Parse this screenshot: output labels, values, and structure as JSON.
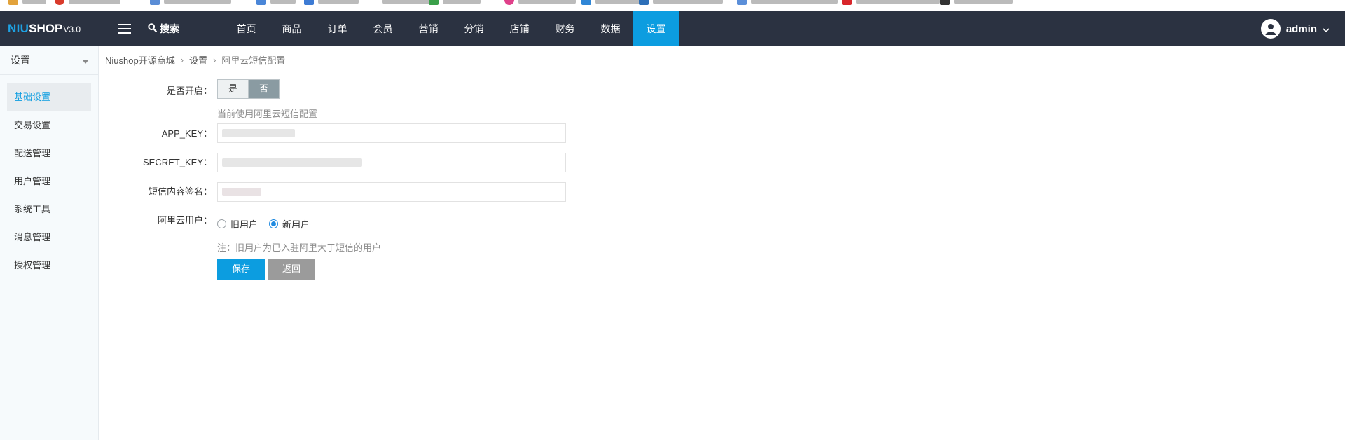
{
  "logo": {
    "part1": "NIU",
    "part2": "SHOP",
    "version": "V3.0"
  },
  "header": {
    "search_label": "搜索",
    "nav": [
      "首页",
      "商品",
      "订单",
      "会员",
      "营销",
      "分销",
      "店铺",
      "财务",
      "数据",
      "设置"
    ],
    "active_nav": "设置",
    "user": "admin"
  },
  "colors": {
    "topbar": "#2b3241",
    "accent": "#0c9de0",
    "logo_accent": "#1ea2e3"
  },
  "sidebar": {
    "title": "设置",
    "items": [
      "基础设置",
      "交易设置",
      "配送管理",
      "用户管理",
      "系统工具",
      "消息管理",
      "授权管理"
    ],
    "active": "基础设置"
  },
  "breadcrumb": [
    "Niushop开源商城",
    "设置",
    "阿里云短信配置"
  ],
  "form": {
    "enable_label": "是否开启：",
    "enable_yes": "是",
    "enable_no": "否",
    "enable_hint": "当前使用阿里云短信配置",
    "app_key_label": "APP_KEY：",
    "secret_key_label": "SECRET_KEY：",
    "signature_label": "短信内容签名：",
    "user_label": "阿里云用户：",
    "user_old": "旧用户",
    "user_new": "新用户",
    "user_selected": "新用户",
    "note": "注：旧用户为已入驻阿里大于短信的用户",
    "save": "保存",
    "back": "返回"
  }
}
